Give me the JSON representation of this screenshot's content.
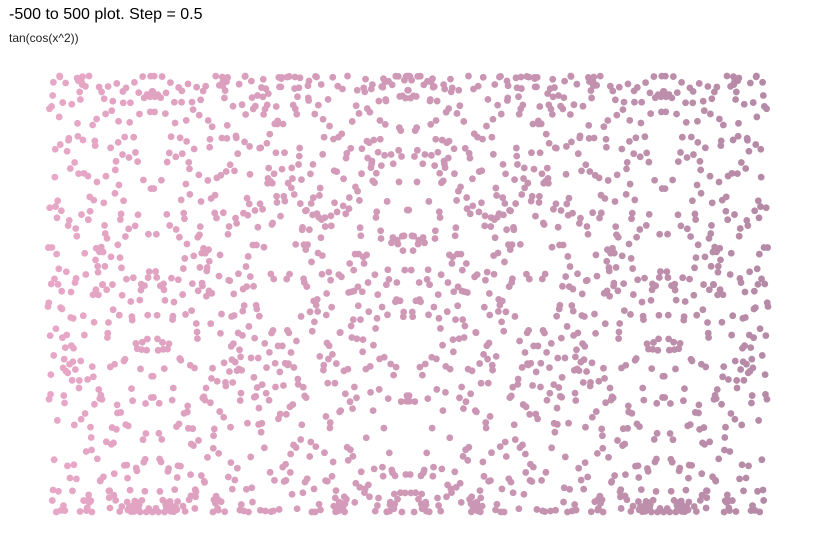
{
  "chart_data": {
    "type": "scatter",
    "title": "-500 to 500 plot. Step = 0.5",
    "subtitle": "tan(cos(x^2))",
    "function": "tan(cos(x^2))",
    "x_range": [
      -500,
      500
    ],
    "step": 0.5,
    "axes_visible": false,
    "grid": false,
    "legend": "none",
    "point_color_gradient": [
      "#e8a7c6",
      "#b58aa6"
    ]
  }
}
